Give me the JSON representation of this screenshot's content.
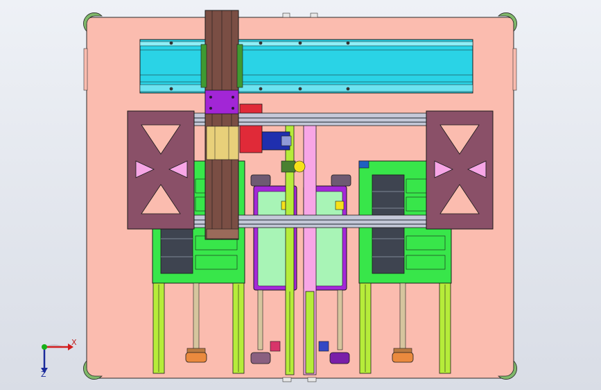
{
  "view": {
    "background_top": "#eef1f6",
    "background_bottom": "#d9dde6"
  },
  "colors": {
    "base_plate": "#fbbcaf",
    "rail_cyan": "#2ad3e6",
    "column_brown": "#7a4e44",
    "bracket_purple": "#8a5068",
    "green_block": "#38e64a",
    "lime_rail": "#b6ec3a",
    "magenta_frame": "#a428d8",
    "pink_rail": "#f7a6e6",
    "mint_panel": "#a8f4b6",
    "gray_beam": "#c4c8d8",
    "dark_slots": "#3e4450",
    "yellow": "#f6e11a",
    "orange_knob": "#ea8a3e",
    "violet_carriage": "#a226d6",
    "red_block": "#e02a38",
    "blue_motor": "#1f2fae"
  },
  "axes": {
    "x_label": "X",
    "z_label": "Z",
    "x_color": "#d21e1e",
    "y_color": "#18b018",
    "z_color": "#1a2a9a"
  }
}
